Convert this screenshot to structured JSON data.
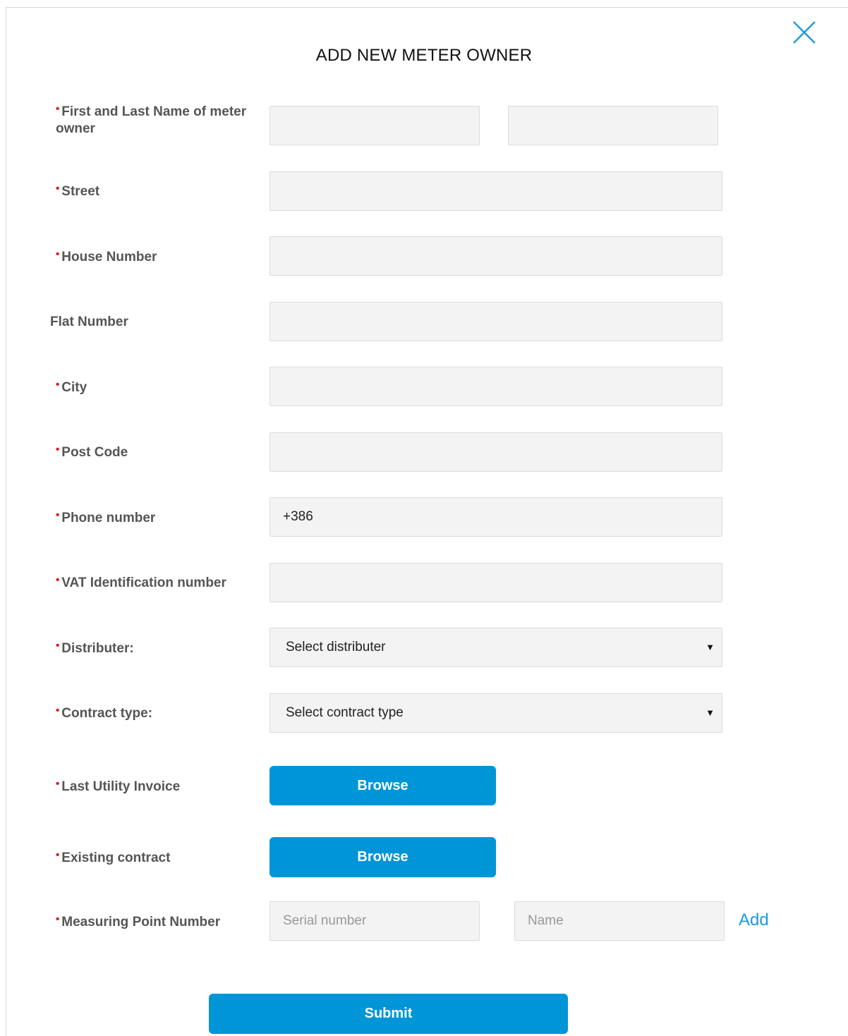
{
  "modal": {
    "title": "ADD NEW METER OWNER",
    "close_icon": "close-icon"
  },
  "form": {
    "name": {
      "label": "First and Last Name of meter owner",
      "required": true,
      "first_value": "",
      "last_value": ""
    },
    "street": {
      "label": "Street",
      "required": true,
      "value": ""
    },
    "house_number": {
      "label": "House Number",
      "required": true,
      "value": ""
    },
    "flat_number": {
      "label": "Flat Number",
      "required": false,
      "value": ""
    },
    "city": {
      "label": "City",
      "required": true,
      "value": ""
    },
    "post_code": {
      "label": "Post Code",
      "required": true,
      "value": ""
    },
    "phone_number": {
      "label": "Phone number",
      "required": true,
      "value": "+386"
    },
    "vat_number": {
      "label": "VAT Identification number",
      "required": true,
      "value": ""
    },
    "distributer": {
      "label": "Distributer:",
      "required": true,
      "selected": "Select distributer"
    },
    "contract_type": {
      "label": "Contract type:",
      "required": true,
      "selected": "Select contract type"
    },
    "last_invoice": {
      "label": "Last Utility Invoice",
      "required": true,
      "button": "Browse"
    },
    "existing_contract": {
      "label": "Existing contract",
      "required": true,
      "button": "Browse"
    },
    "measuring_point": {
      "label": "Measuring Point Number",
      "required": true,
      "serial_placeholder": "Serial number",
      "name_placeholder": "Name",
      "add_link": "Add"
    },
    "required_marker": "•",
    "submit": "Submit"
  },
  "colors": {
    "accent": "#0095d6",
    "required": "#e0141b",
    "link": "#1a9be0",
    "input_bg": "#f3f3f3"
  }
}
